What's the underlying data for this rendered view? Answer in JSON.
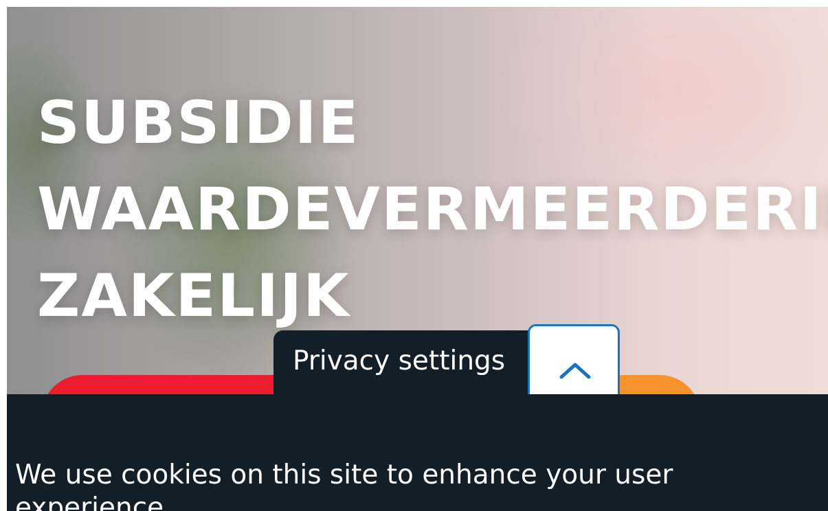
{
  "hero": {
    "title_lines": [
      "SUBSIDIE",
      "WAARDEVERMEERDERING",
      "ZAKELIJK"
    ]
  },
  "privacy": {
    "tab_label": "Privacy settings",
    "toggle_icon": "chevron-up-icon",
    "message": "We use cookies on this site to enhance your user experience"
  },
  "colors": {
    "banner_bg": "#121f29",
    "cta_red": "#ed1c2e",
    "cta_orange": "#f7932f",
    "toggle_accent": "#1e72b9"
  }
}
